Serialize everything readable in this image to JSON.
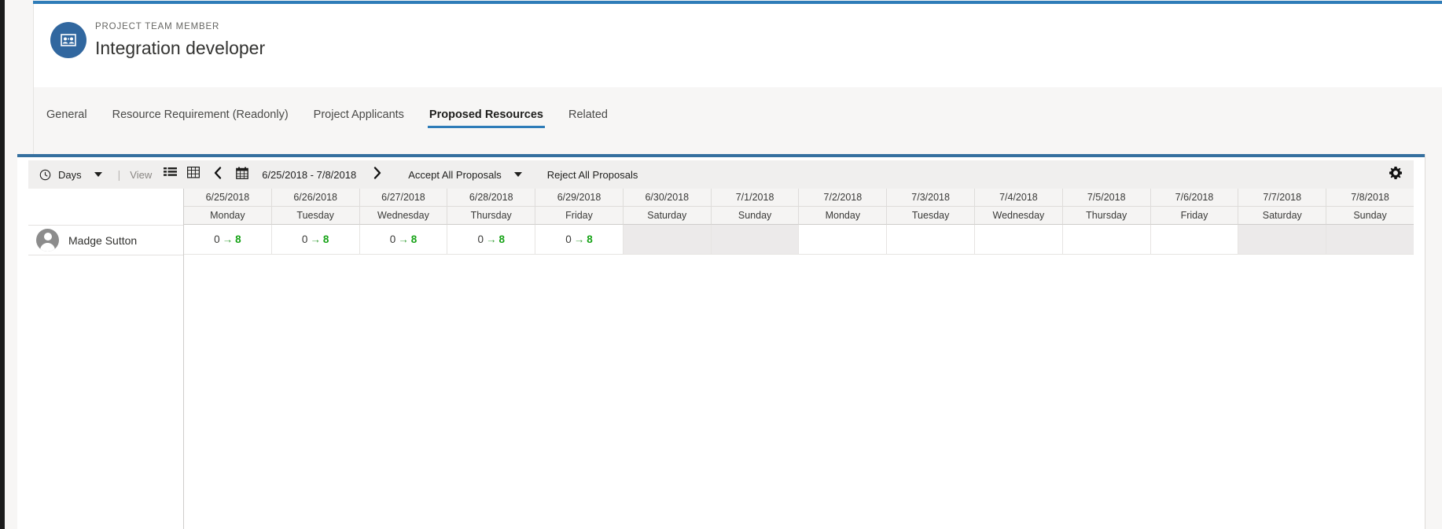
{
  "header": {
    "eyebrow": "PROJECT TEAM MEMBER",
    "title": "Integration developer",
    "avatar_icon": "project-team-member-icon",
    "accent_color": "#31679f"
  },
  "tabs": [
    {
      "label": "General",
      "active": false
    },
    {
      "label": "Resource Requirement (Readonly)",
      "active": false
    },
    {
      "label": "Project Applicants",
      "active": false
    },
    {
      "label": "Proposed Resources",
      "active": true
    },
    {
      "label": "Related",
      "active": false
    }
  ],
  "toolbar": {
    "clock_icon": "clock-icon",
    "scale_label": "Days",
    "separator": "|",
    "view_label": "View",
    "list_view_icon": "list-view-icon",
    "grid_view_icon": "grid-view-icon",
    "prev_icon": "chevron-left-icon",
    "calendar_icon": "calendar-icon",
    "date_range": "6/25/2018 - 7/8/2018",
    "next_icon": "chevron-right-icon",
    "accept_all_label": "Accept All Proposals",
    "reject_all_label": "Reject All Proposals",
    "settings_icon": "gear-icon"
  },
  "grid": {
    "resource_column_header": "",
    "columns": [
      {
        "date": "6/25/2018",
        "day": "Monday",
        "weekend": false
      },
      {
        "date": "6/26/2018",
        "day": "Tuesday",
        "weekend": false
      },
      {
        "date": "6/27/2018",
        "day": "Wednesday",
        "weekend": false
      },
      {
        "date": "6/28/2018",
        "day": "Thursday",
        "weekend": false
      },
      {
        "date": "6/29/2018",
        "day": "Friday",
        "weekend": false
      },
      {
        "date": "6/30/2018",
        "day": "Saturday",
        "weekend": true
      },
      {
        "date": "7/1/2018",
        "day": "Sunday",
        "weekend": true
      },
      {
        "date": "7/2/2018",
        "day": "Monday",
        "weekend": false
      },
      {
        "date": "7/3/2018",
        "day": "Tuesday",
        "weekend": false
      },
      {
        "date": "7/4/2018",
        "day": "Wednesday",
        "weekend": false
      },
      {
        "date": "7/5/2018",
        "day": "Thursday",
        "weekend": false
      },
      {
        "date": "7/6/2018",
        "day": "Friday",
        "weekend": false
      },
      {
        "date": "7/7/2018",
        "day": "Saturday",
        "weekend": true
      },
      {
        "date": "7/8/2018",
        "day": "Sunday",
        "weekend": true
      }
    ],
    "rows": [
      {
        "name": "Madge Sutton",
        "avatar_icon": "person-avatar-icon",
        "cells": [
          {
            "from": "0",
            "arrow": "→",
            "to": "8"
          },
          {
            "from": "0",
            "arrow": "→",
            "to": "8"
          },
          {
            "from": "0",
            "arrow": "→",
            "to": "8"
          },
          {
            "from": "0",
            "arrow": "→",
            "to": "8"
          },
          {
            "from": "0",
            "arrow": "→",
            "to": "8"
          },
          {
            "from": "",
            "arrow": "",
            "to": ""
          },
          {
            "from": "",
            "arrow": "",
            "to": ""
          },
          {
            "from": "",
            "arrow": "",
            "to": ""
          },
          {
            "from": "",
            "arrow": "",
            "to": ""
          },
          {
            "from": "",
            "arrow": "",
            "to": ""
          },
          {
            "from": "",
            "arrow": "",
            "to": ""
          },
          {
            "from": "",
            "arrow": "",
            "to": ""
          },
          {
            "from": "",
            "arrow": "",
            "to": ""
          },
          {
            "from": "",
            "arrow": "",
            "to": ""
          }
        ]
      }
    ]
  },
  "colors": {
    "accent_blue": "#2e7cb8",
    "panel_accent": "#35709f",
    "proposal_green": "#17a317",
    "weekend_shade": "#eceaea"
  }
}
